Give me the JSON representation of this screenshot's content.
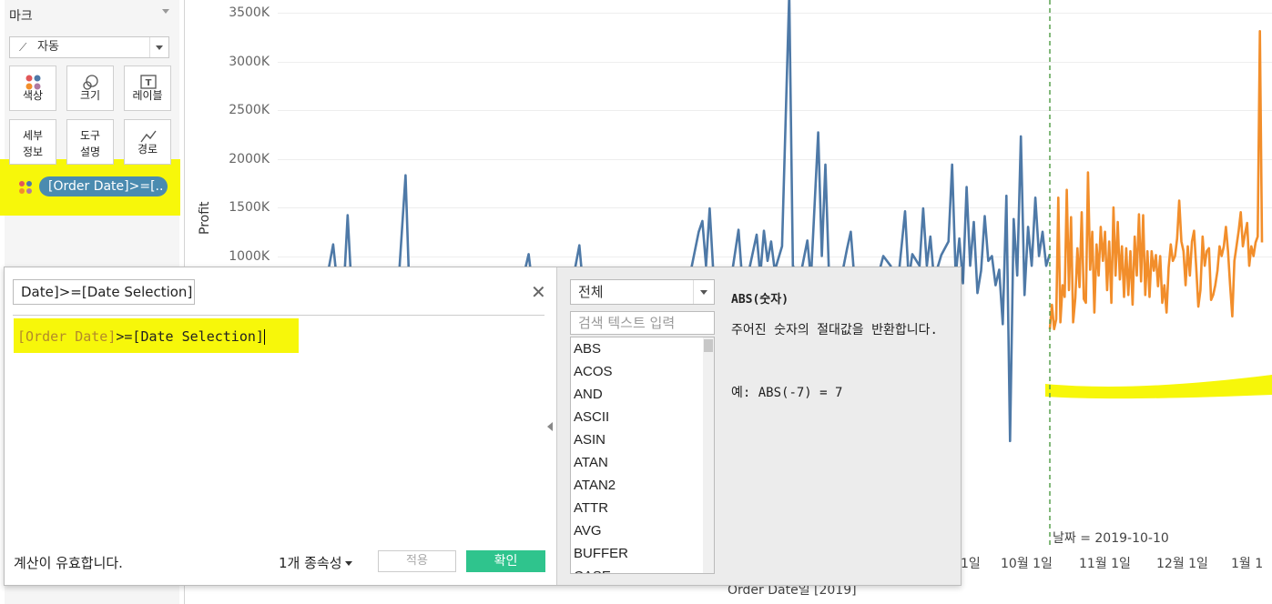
{
  "marks": {
    "title": "마크",
    "mark_type": "자동",
    "buttons": {
      "color": "색상",
      "size": "크기",
      "label": "레이블",
      "detail": "세부\n정보",
      "tooltip": "도구\n설명",
      "path": "경로"
    },
    "pill": "[Order Date]>=[.."
  },
  "chart": {
    "y_axis_label": "Profit",
    "y_ticks": [
      "3500K",
      "3000K",
      "2500K",
      "2000K",
      "1500K",
      "1000K"
    ],
    "x_ticks": [
      "1일",
      "10월 1일",
      "11월 1일",
      "12월 1일",
      "1월 1"
    ],
    "x_axis_label": "Order Date일 [2019]",
    "reference_line_label": "날짜 = 2019-10-10",
    "colors": {
      "before": "#4e79a7",
      "after": "#f28e2b",
      "reference": "#59a14f",
      "highlight": "#f7f70a"
    }
  },
  "chart_data": {
    "type": "line",
    "ylabel": "Profit",
    "xlabel": "Order Date일 [2019]",
    "ylim": [
      0,
      3600000
    ],
    "reference_line": "2019-10-10",
    "series": [
      {
        "color": "#4e79a7",
        "values": [
          [
            0.0,
            720000
          ],
          [
            0.01,
            1120000
          ],
          [
            0.015,
            760000
          ],
          [
            0.025,
            720000
          ],
          [
            0.03,
            1420000
          ],
          [
            0.035,
            720000
          ],
          [
            0.045,
            700000
          ],
          [
            0.06,
            700000
          ],
          [
            0.07,
            720000
          ],
          [
            0.08,
            700000
          ],
          [
            0.09,
            720000
          ],
          [
            0.1,
            700000
          ],
          [
            0.11,
            1830000
          ],
          [
            0.115,
            700000
          ],
          [
            0.13,
            720000
          ],
          [
            0.15,
            700000
          ],
          [
            0.17,
            710000
          ],
          [
            0.19,
            700000
          ],
          [
            0.21,
            720000
          ],
          [
            0.23,
            700000
          ],
          [
            0.25,
            710000
          ],
          [
            0.27,
            700000
          ],
          [
            0.28,
            1020000
          ],
          [
            0.285,
            700000
          ],
          [
            0.3,
            720000
          ],
          [
            0.32,
            700000
          ],
          [
            0.34,
            710000
          ],
          [
            0.35,
            1110000
          ],
          [
            0.355,
            700000
          ],
          [
            0.37,
            720000
          ],
          [
            0.39,
            700000
          ],
          [
            0.41,
            710000
          ],
          [
            0.43,
            700000
          ],
          [
            0.45,
            720000
          ],
          [
            0.47,
            700000
          ],
          [
            0.49,
            710000
          ],
          [
            0.5,
            700000
          ],
          [
            0.515,
            1250000
          ],
          [
            0.52,
            1360000
          ],
          [
            0.525,
            900000
          ],
          [
            0.53,
            1490000
          ],
          [
            0.535,
            850000
          ],
          [
            0.55,
            700000
          ],
          [
            0.56,
            780000
          ],
          [
            0.57,
            1270000
          ],
          [
            0.575,
            760000
          ],
          [
            0.58,
            700000
          ],
          [
            0.595,
            1220000
          ],
          [
            0.6,
            800000
          ],
          [
            0.605,
            1260000
          ],
          [
            0.61,
            950000
          ],
          [
            0.615,
            1150000
          ],
          [
            0.62,
            850000
          ],
          [
            0.63,
            1100000
          ],
          [
            0.64,
            3700000
          ],
          [
            0.645,
            900000
          ],
          [
            0.655,
            780000
          ],
          [
            0.665,
            1160000
          ],
          [
            0.67,
            760000
          ],
          [
            0.68,
            2270000
          ],
          [
            0.685,
            1000000
          ],
          [
            0.69,
            1940000
          ],
          [
            0.695,
            800000
          ],
          [
            0.71,
            700000
          ],
          [
            0.72,
            1080000
          ],
          [
            0.725,
            1250000
          ],
          [
            0.73,
            760000
          ],
          [
            0.74,
            780000
          ],
          [
            0.75,
            700000
          ],
          [
            0.76,
            720000
          ],
          [
            0.77,
            1000000
          ],
          [
            0.78,
            900000
          ],
          [
            0.79,
            720000
          ],
          [
            0.8,
            1460000
          ],
          [
            0.805,
            760000
          ],
          [
            0.81,
            1020000
          ],
          [
            0.82,
            900000
          ],
          [
            0.825,
            1490000
          ],
          [
            0.83,
            900000
          ],
          [
            0.835,
            1200000
          ],
          [
            0.84,
            760000
          ],
          [
            0.85,
            1010000
          ],
          [
            0.86,
            1150000
          ],
          [
            0.865,
            1940000
          ],
          [
            0.87,
            800000
          ],
          [
            0.875,
            1180000
          ],
          [
            0.88,
            720000
          ],
          [
            0.885,
            1710000
          ],
          [
            0.89,
            900000
          ],
          [
            0.895,
            1350000
          ],
          [
            0.9,
            620000
          ],
          [
            0.905,
            850000
          ],
          [
            0.91,
            1410000
          ],
          [
            0.915,
            950000
          ],
          [
            0.92,
            1000000
          ],
          [
            0.925,
            700000
          ],
          [
            0.93,
            860000
          ],
          [
            0.935,
            300000
          ],
          [
            0.94,
            1620000
          ],
          [
            0.945,
            -900000
          ],
          [
            0.95,
            1380000
          ],
          [
            0.955,
            800000
          ],
          [
            0.96,
            2230000
          ],
          [
            0.965,
            600000
          ],
          [
            0.97,
            1300000
          ],
          [
            0.975,
            900000
          ],
          [
            0.98,
            1600000
          ],
          [
            0.985,
            1000000
          ],
          [
            0.99,
            1250000
          ],
          [
            0.995,
            900000
          ],
          [
            1.0,
            1020000
          ]
        ]
      },
      {
        "color": "#f28e2b",
        "values": [
          [
            0.0,
            250000
          ],
          [
            0.01,
            500000
          ],
          [
            0.02,
            250000
          ],
          [
            0.03,
            350000
          ],
          [
            0.04,
            1600000
          ],
          [
            0.05,
            320000
          ],
          [
            0.06,
            700000
          ],
          [
            0.07,
            580000
          ],
          [
            0.08,
            1680000
          ],
          [
            0.09,
            650000
          ],
          [
            0.1,
            1400000
          ],
          [
            0.11,
            320000
          ],
          [
            0.12,
            570000
          ],
          [
            0.13,
            1080000
          ],
          [
            0.14,
            680000
          ],
          [
            0.15,
            1450000
          ],
          [
            0.16,
            560000
          ],
          [
            0.17,
            520000
          ],
          [
            0.18,
            1860000
          ],
          [
            0.19,
            860000
          ],
          [
            0.2,
            1250000
          ],
          [
            0.21,
            420000
          ],
          [
            0.22,
            1120000
          ],
          [
            0.23,
            800000
          ],
          [
            0.24,
            1300000
          ],
          [
            0.25,
            950000
          ],
          [
            0.26,
            1250000
          ],
          [
            0.27,
            650000
          ],
          [
            0.28,
            1150000
          ],
          [
            0.29,
            520000
          ],
          [
            0.3,
            1500000
          ],
          [
            0.31,
            800000
          ],
          [
            0.32,
            1350000
          ],
          [
            0.33,
            760000
          ],
          [
            0.34,
            1100000
          ],
          [
            0.35,
            580000
          ],
          [
            0.36,
            1080000
          ],
          [
            0.37,
            600000
          ],
          [
            0.38,
            1050000
          ],
          [
            0.39,
            500000
          ],
          [
            0.4,
            1200000
          ],
          [
            0.41,
            800000
          ],
          [
            0.42,
            1430000
          ],
          [
            0.43,
            740000
          ],
          [
            0.44,
            1420000
          ],
          [
            0.45,
            600000
          ],
          [
            0.46,
            1050000
          ],
          [
            0.47,
            580000
          ],
          [
            0.48,
            1050000
          ],
          [
            0.49,
            850000
          ],
          [
            0.5,
            1010000
          ],
          [
            0.51,
            690000
          ],
          [
            0.52,
            1000000
          ],
          [
            0.53,
            520000
          ],
          [
            0.54,
            700000
          ],
          [
            0.55,
            420000
          ],
          [
            0.56,
            880000
          ],
          [
            0.57,
            1120000
          ],
          [
            0.58,
            950000
          ],
          [
            0.59,
            1000000
          ],
          [
            0.6,
            1180000
          ],
          [
            0.61,
            1570000
          ],
          [
            0.62,
            1150000
          ],
          [
            0.63,
            1050000
          ],
          [
            0.64,
            700000
          ],
          [
            0.65,
            1100000
          ],
          [
            0.66,
            800000
          ],
          [
            0.67,
            1150000
          ],
          [
            0.68,
            1260000
          ],
          [
            0.69,
            880000
          ],
          [
            0.7,
            480000
          ],
          [
            0.71,
            650000
          ],
          [
            0.72,
            1200000
          ],
          [
            0.73,
            900000
          ],
          [
            0.74,
            1050000
          ],
          [
            0.75,
            1080000
          ],
          [
            0.76,
            550000
          ],
          [
            0.77,
            600000
          ],
          [
            0.78,
            700000
          ],
          [
            0.79,
            850000
          ],
          [
            0.8,
            1100000
          ],
          [
            0.81,
            1000000
          ],
          [
            0.82,
            1100000
          ],
          [
            0.83,
            1300000
          ],
          [
            0.84,
            1050000
          ],
          [
            0.85,
            700000
          ],
          [
            0.86,
            380000
          ],
          [
            0.87,
            950000
          ],
          [
            0.88,
            1100000
          ],
          [
            0.89,
            1260000
          ],
          [
            0.9,
            1450000
          ],
          [
            0.91,
            1100000
          ],
          [
            0.92,
            1230000
          ],
          [
            0.93,
            1340000
          ],
          [
            0.94,
            900000
          ],
          [
            0.95,
            1100000
          ],
          [
            0.96,
            1000000
          ],
          [
            0.97,
            1140000
          ],
          [
            0.98,
            1200000
          ],
          [
            0.99,
            3310000
          ],
          [
            1.0,
            1140000
          ]
        ]
      }
    ]
  },
  "calc": {
    "name": "Date]>=[Date Selection]",
    "formula_field": "[Order Date]",
    "formula_rest": ">=[Date Selection]",
    "status": "계산이 유효합니다.",
    "dependencies": "1개 종속성",
    "apply": "적용",
    "ok": "확인",
    "category": "전체",
    "search_placeholder": "검색 텍스트 입력",
    "functions": [
      "ABS",
      "ACOS",
      "AND",
      "ASCII",
      "ASIN",
      "ATAN",
      "ATAN2",
      "ATTR",
      "AVG",
      "BUFFER",
      "CASE"
    ],
    "help": {
      "title": "ABS(숫자)",
      "desc": "주어진 숫자의 절대값을 반환합니다.",
      "example": "예: ABS(-7) = 7"
    }
  }
}
